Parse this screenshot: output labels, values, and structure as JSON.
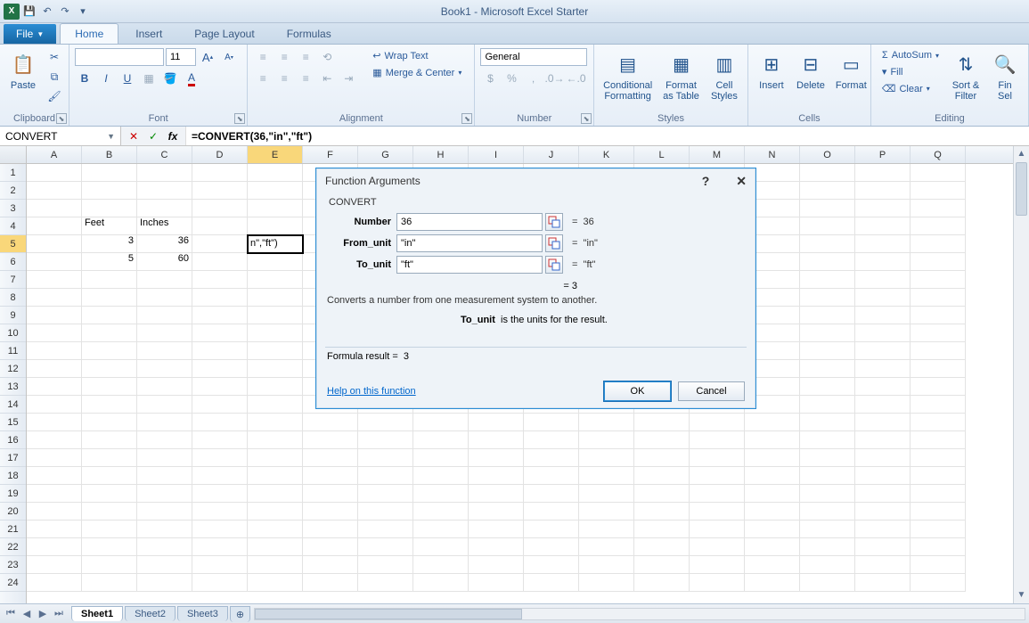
{
  "titlebar": {
    "title": "Book1 - Microsoft Excel Starter"
  },
  "tabs": {
    "file": "File",
    "home": "Home",
    "insert": "Insert",
    "pagelayout": "Page Layout",
    "formulas": "Formulas"
  },
  "ribbon": {
    "clipboard": {
      "label": "Clipboard",
      "paste": "Paste"
    },
    "font": {
      "label": "Font",
      "size": "11",
      "bold": "B",
      "italic": "I",
      "underline": "U",
      "incA": "A",
      "decA": "A"
    },
    "alignment": {
      "label": "Alignment",
      "wrap": "Wrap Text",
      "merge": "Merge & Center"
    },
    "number": {
      "label": "Number",
      "format": "General",
      "currency": "$",
      "percent": "%",
      "comma": ","
    },
    "styles": {
      "label": "Styles",
      "cond": "Conditional\nFormatting",
      "table": "Format\nas Table",
      "cell": "Cell\nStyles"
    },
    "cells": {
      "label": "Cells",
      "insert": "Insert",
      "delete": "Delete",
      "format": "Format"
    },
    "editing": {
      "label": "Editing",
      "autosum": "AutoSum",
      "fill": "Fill",
      "clear": "Clear",
      "sort": "Sort &\nFilter",
      "find": "Fin\nSel"
    }
  },
  "namebox": "CONVERT",
  "formula": "=CONVERT(36,\"in\",\"ft\")",
  "headers": {
    "feet": "Feet",
    "inches": "Inches"
  },
  "data": {
    "r5": {
      "b": "3",
      "c": "36"
    },
    "r6": {
      "b": "5",
      "c": "60"
    }
  },
  "active_cell_display": "n\",\"ft\")",
  "columns": [
    "A",
    "B",
    "C",
    "D",
    "E",
    "F",
    "G",
    "H",
    "I",
    "J",
    "K",
    "L",
    "M",
    "N",
    "O",
    "P",
    "Q"
  ],
  "rows_count": 24,
  "active_col_index": 4,
  "active_row_index": 4,
  "sheets": {
    "s1": "Sheet1",
    "s2": "Sheet2",
    "s3": "Sheet3"
  },
  "dialog": {
    "title": "Function Arguments",
    "fn": "CONVERT",
    "args": [
      {
        "label": "Number",
        "value": "36",
        "eval": "36"
      },
      {
        "label": "From_unit",
        "value": "\"in\"",
        "eval": "\"in\""
      },
      {
        "label": "To_unit",
        "value": "\"ft\"",
        "eval": "\"ft\""
      }
    ],
    "fn_result": "3",
    "description": "Converts a number from one measurement system to another.",
    "arg_help_label": "To_unit",
    "arg_help_text": "is the units for the result.",
    "formula_result_label": "Formula result =",
    "formula_result": "3",
    "help_link": "Help on this function",
    "ok": "OK",
    "cancel": "Cancel"
  }
}
